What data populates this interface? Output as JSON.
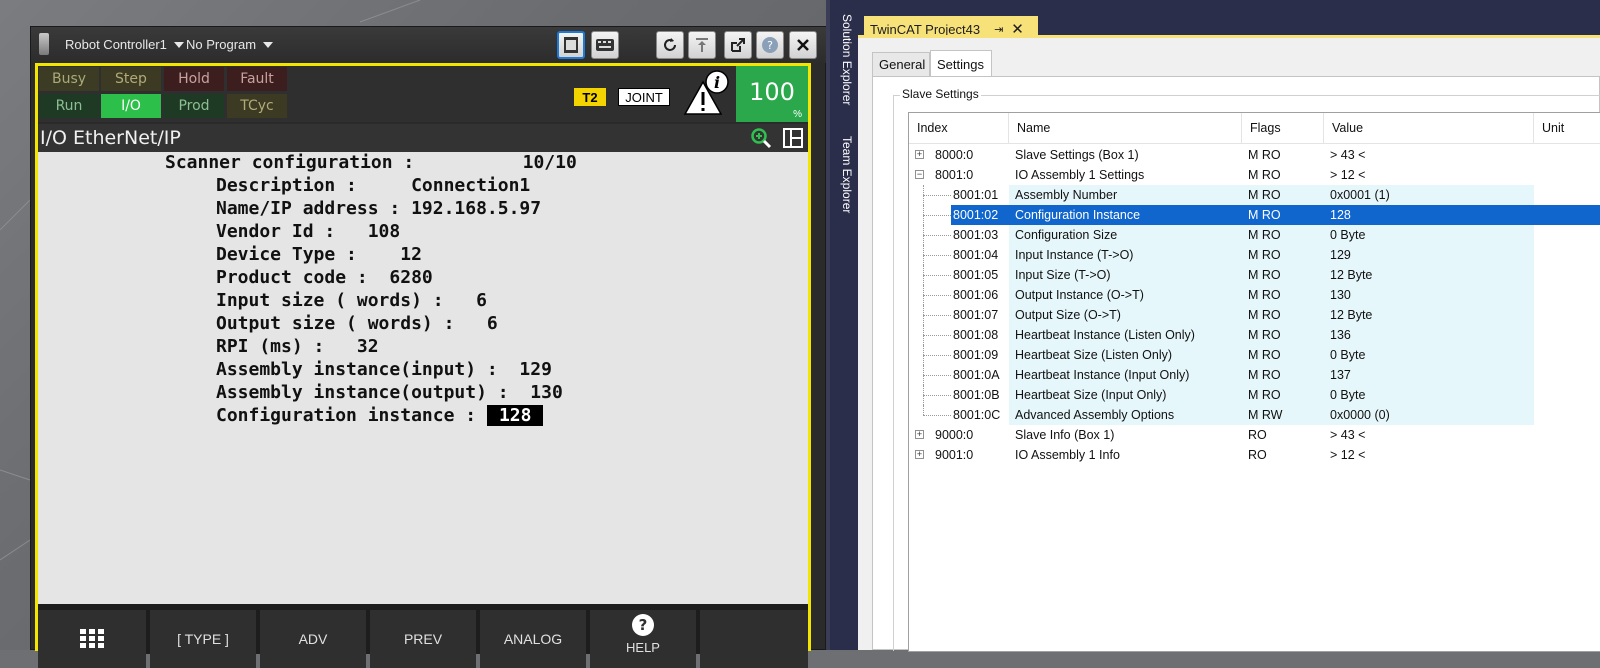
{
  "pendant": {
    "controller": "Robot Controller1",
    "program": "No Program",
    "status": {
      "busy": "Busy",
      "step": "Step",
      "hold": "Hold",
      "fault": "Fault",
      "run": "Run",
      "io": "I/O",
      "prod": "Prod",
      "tcyc": "TCyc"
    },
    "mode": "T2",
    "coord": "JOINT",
    "override": "100",
    "override_unit": "%",
    "screen_title": "I/O EtherNet/IP",
    "lines": [
      "Scanner configuration :          10/10",
      "Description :     Connection1",
      "Name/IP address : 192.168.5.97",
      "Vendor Id :   108",
      "Device Type :    12",
      "Product code :  6280",
      "Input size ( words) :   6",
      "Output size ( words) :   6",
      "RPI (ms) :   32",
      "Assembly instance(input) :  129",
      "Assembly instance(output) :  130",
      "Configuration instance : "
    ],
    "config_value": "128",
    "fkeys": [
      "",
      "[ TYPE ]",
      "ADV",
      "PREV",
      "ANALOG",
      "HELP",
      ""
    ],
    "colors": {
      "frame": "#f2e600",
      "io_on": "#2cc04a",
      "override_bg": "#2aa84b"
    }
  },
  "ide": {
    "side_tabs": [
      "Solution Explorer",
      "Team Explorer"
    ],
    "doc_tab": "TwinCAT Project43",
    "tabs": [
      "General",
      "Settings"
    ],
    "active_tab": "Settings",
    "group_label": "Slave Settings",
    "columns": [
      "Index",
      "Name",
      "Flags",
      "Value",
      "Unit"
    ],
    "rows": [
      {
        "index": "8000:0",
        "name": "Slave Settings (Box 1)",
        "flags": "M RO",
        "value": "> 43 <",
        "expander": "+"
      },
      {
        "index": "8001:0",
        "name": "IO Assembly 1 Settings",
        "flags": "M RO",
        "value": "> 12 <",
        "expander": "-"
      },
      {
        "index": "8001:01",
        "name": "Assembly Number",
        "flags": "M RO",
        "value": "0x0001 (1)"
      },
      {
        "index": "8001:02",
        "name": "Configuration Instance",
        "flags": "M RO",
        "value": "128",
        "selected": true
      },
      {
        "index": "8001:03",
        "name": "Configuration Size",
        "flags": "M RO",
        "value": "0 Byte"
      },
      {
        "index": "8001:04",
        "name": "Input Instance (T->O)",
        "flags": "M RO",
        "value": "129"
      },
      {
        "index": "8001:05",
        "name": "Input Size (T->O)",
        "flags": "M RO",
        "value": "12 Byte"
      },
      {
        "index": "8001:06",
        "name": "Output Instance (O->T)",
        "flags": "M RO",
        "value": "130"
      },
      {
        "index": "8001:07",
        "name": "Output Size (O->T)",
        "flags": "M RO",
        "value": "12 Byte"
      },
      {
        "index": "8001:08",
        "name": "Heartbeat Instance (Listen Only)",
        "flags": "M RO",
        "value": "136"
      },
      {
        "index": "8001:09",
        "name": "Heartbeat Size (Listen Only)",
        "flags": "M RO",
        "value": "0 Byte"
      },
      {
        "index": "8001:0A",
        "name": "Heartbeat Instance (Input Only)",
        "flags": "M RO",
        "value": "137"
      },
      {
        "index": "8001:0B",
        "name": "Heartbeat Size (Input Only)",
        "flags": "M RO",
        "value": "0 Byte"
      },
      {
        "index": "8001:0C",
        "name": "Advanced Assembly Options",
        "flags": "M RW",
        "value": "0x0000 (0)"
      },
      {
        "index": "9000:0",
        "name": "Slave Info (Box 1)",
        "flags": "RO",
        "value": "> 43 <",
        "expander": "+"
      },
      {
        "index": "9001:0",
        "name": "IO Assembly 1 Info",
        "flags": "RO",
        "value": "> 12 <",
        "expander": "+"
      }
    ],
    "colors": {
      "selection": "#1066cc",
      "alt_row": "#e6f7fb",
      "doc_tab": "#f7e27a",
      "chrome": "#2a2e4a"
    }
  }
}
